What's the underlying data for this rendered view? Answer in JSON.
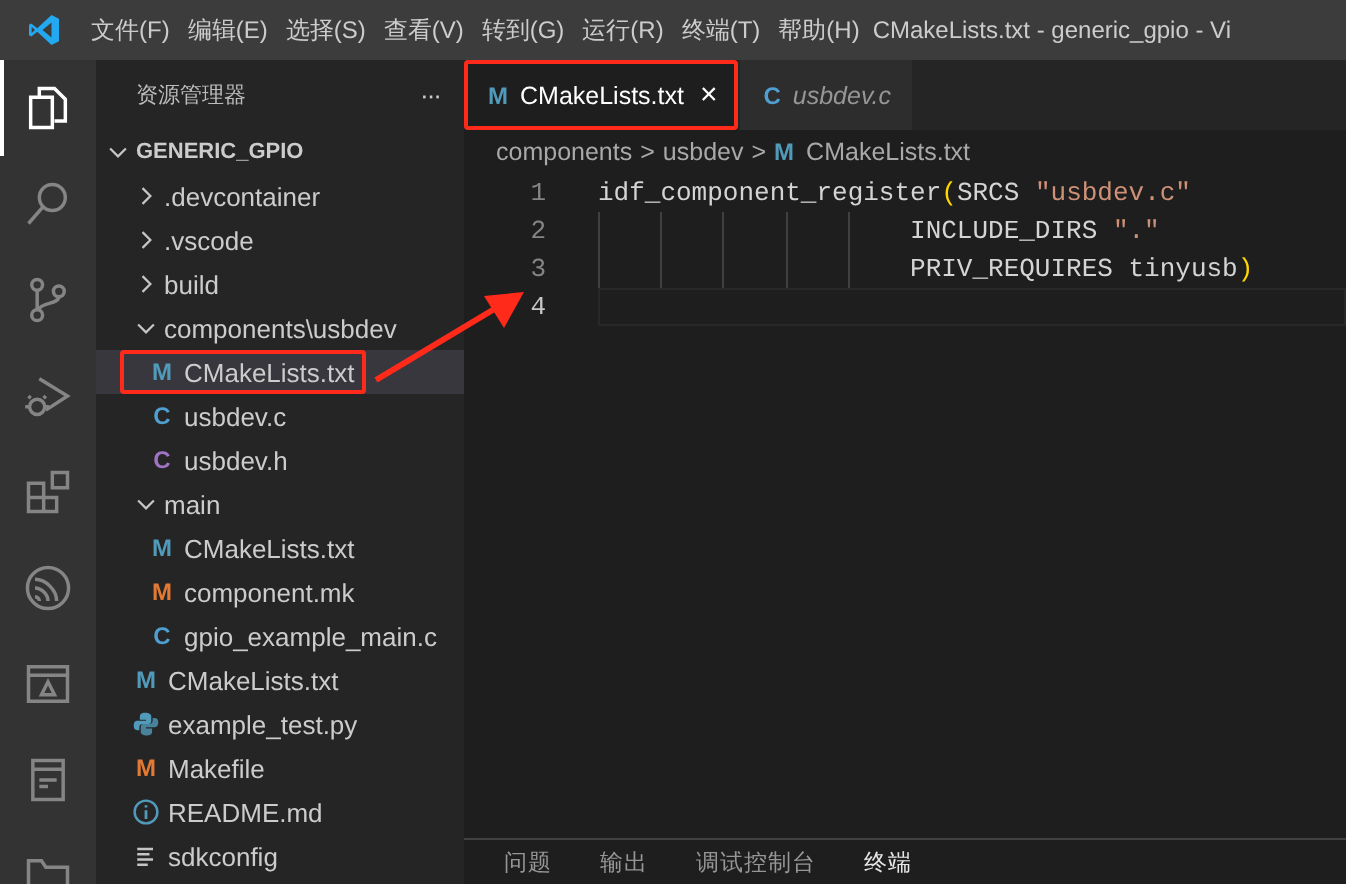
{
  "menu": [
    "文件(F)",
    "编辑(E)",
    "选择(S)",
    "查看(V)",
    "转到(G)",
    "运行(R)",
    "终端(T)",
    "帮助(H)"
  ],
  "window": {
    "title": "CMakeLists.txt - generic_gpio - Vi"
  },
  "activity_bar": [
    {
      "kind": "explorer",
      "selected": true
    },
    {
      "kind": "search",
      "selected": false
    },
    {
      "kind": "source-control",
      "selected": false
    },
    {
      "kind": "run-debug",
      "selected": false
    },
    {
      "kind": "extensions",
      "selected": false
    },
    {
      "kind": "espressif",
      "selected": false
    },
    {
      "kind": "remote",
      "selected": false
    },
    {
      "kind": "notes",
      "selected": false
    },
    {
      "kind": "folder",
      "selected": false
    }
  ],
  "sidebar": {
    "title": "资源管理器",
    "more": "···",
    "tree": {
      "label": "GENERIC_GPIO",
      "kind": "folder",
      "expanded": true,
      "children": [
        {
          "label": ".devcontainer",
          "kind": "folder",
          "expanded": false
        },
        {
          "label": ".vscode",
          "kind": "folder",
          "expanded": false
        },
        {
          "label": "build",
          "kind": "folder",
          "expanded": false
        },
        {
          "label": "components\\usbdev",
          "kind": "folder",
          "expanded": true,
          "children": [
            {
              "label": "CMakeLists.txt",
              "kind": "cmake",
              "glyph": "M",
              "selected": true,
              "annotated": true
            },
            {
              "label": "usbdev.c",
              "kind": "c",
              "glyph": "C",
              "selected": false,
              "annotated": false
            },
            {
              "label": "usbdev.h",
              "kind": "h",
              "glyph": "C",
              "selected": false,
              "annotated": false
            }
          ]
        },
        {
          "label": "main",
          "kind": "folder",
          "expanded": true,
          "children": [
            {
              "label": "CMakeLists.txt",
              "kind": "cmake",
              "glyph": "M",
              "selected": false,
              "annotated": false
            },
            {
              "label": "component.mk",
              "kind": "make",
              "glyph": "M",
              "selected": false,
              "annotated": false
            },
            {
              "label": "gpio_example_main.c",
              "kind": "c",
              "glyph": "C",
              "selected": false,
              "annotated": false
            }
          ]
        },
        {
          "label": "CMakeLists.txt",
          "kind": "cmake",
          "glyph": "M",
          "selected": false,
          "annotated": false
        },
        {
          "label": "example_test.py",
          "kind": "python",
          "selected": false,
          "annotated": false
        },
        {
          "label": "Makefile",
          "kind": "make",
          "glyph": "M",
          "selected": false,
          "annotated": false
        },
        {
          "label": "README.md",
          "kind": "info",
          "selected": false,
          "annotated": false
        },
        {
          "label": "sdkconfig",
          "kind": "config",
          "selected": false,
          "annotated": false
        }
      ]
    }
  },
  "tabs": [
    {
      "label": "CMakeLists.txt",
      "kind": "cmake",
      "glyph": "M",
      "selected": true,
      "preview": false,
      "annotated": true,
      "close": "×"
    },
    {
      "label": "usbdev.c",
      "kind": "c",
      "glyph": "C",
      "selected": false,
      "preview": true,
      "annotated": false
    }
  ],
  "breadcrumbs": [
    {
      "label": "components"
    },
    {
      "label": "usbdev"
    },
    {
      "label": "CMakeLists.txt",
      "kind": "cmake",
      "glyph": "M"
    }
  ],
  "breadcrumb_separator": ">",
  "code": [
    {
      "number": "1",
      "current": false,
      "tokens": [
        {
          "kind": "plain",
          "text": "idf_component_register"
        },
        {
          "kind": "paren",
          "text": "("
        },
        {
          "kind": "plain",
          "text": "SRCS "
        },
        {
          "kind": "string",
          "text": "\"usbdev.c\""
        }
      ]
    },
    {
      "number": "2",
      "current": false,
      "tokens": [
        {
          "kind": "plain",
          "text": "                    INCLUDE_DIRS "
        },
        {
          "kind": "string",
          "text": "\".\""
        }
      ]
    },
    {
      "number": "3",
      "current": false,
      "tokens": [
        {
          "kind": "plain",
          "text": "                    PRIV_REQUIRES tinyusb"
        },
        {
          "kind": "paren",
          "text": ")"
        }
      ]
    },
    {
      "number": "4",
      "current": true
    }
  ],
  "panel_tabs": [
    {
      "label": "问题",
      "selected": false
    },
    {
      "label": "输出",
      "selected": false
    },
    {
      "label": "调试控制台",
      "selected": false
    },
    {
      "label": "终端",
      "selected": true
    }
  ]
}
